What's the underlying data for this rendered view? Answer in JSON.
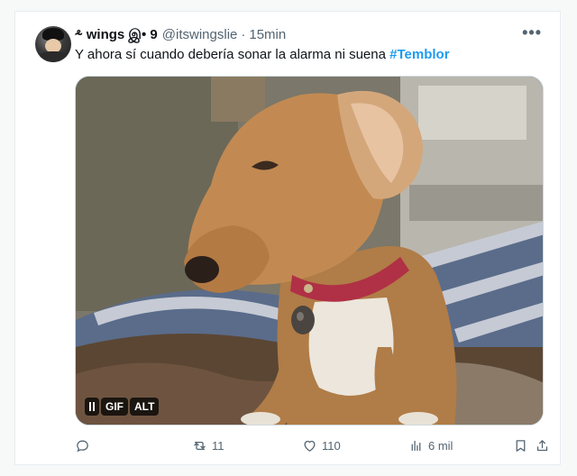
{
  "author": {
    "display_name": "⸛ wings இ• 9",
    "handle": "@itswingslie",
    "separator": "·",
    "time": "15min",
    "more_label": "•••"
  },
  "tweet": {
    "text": "Y ahora sí cuando debería sonar la alarma ni suena ",
    "hashtag": "#Temblor"
  },
  "media": {
    "badges": {
      "gif": "GIF",
      "alt": "ALT"
    }
  },
  "actions": {
    "reply_count": "",
    "retweet_count": "11",
    "like_count": "110",
    "views_count": "6 mil"
  },
  "colors": {
    "accent": "#1d9bf0",
    "secondary_text": "#536471",
    "primary_text": "#0f1419"
  },
  "icons": [
    "reply-icon",
    "retweet-icon",
    "like-icon",
    "views-icon",
    "bookmark-icon",
    "share-icon",
    "pause-icon",
    "more-icon"
  ]
}
